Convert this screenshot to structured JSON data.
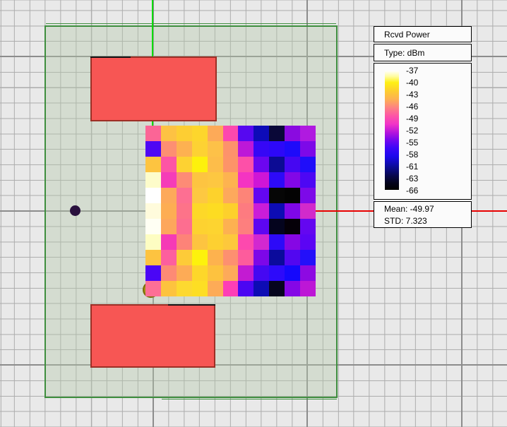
{
  "theme": {
    "bg": "#e9e9e9",
    "grid-minor": "#acacac",
    "grid-major": "#8c8c8c",
    "boundary": "#3e8e3e",
    "scene-tint": "rgba(180,200,170,0.4)",
    "axis-green": "#00dc00",
    "axis-red": "#e80000",
    "obstacle-fill": "#f75654",
    "obstacle-border": "#9c2f26",
    "marker-olive": "#a29210",
    "marker-purple": "#2a113e",
    "panel-bg": "#fbfbfb"
  },
  "legend": {
    "title": "Rcvd Power",
    "type_label": "Type: dBm",
    "ticks": [
      "-37",
      "-40",
      "-43",
      "-46",
      "-49",
      "-52",
      "-55",
      "-58",
      "-61",
      "-63",
      "-66"
    ],
    "mean_label": "Mean: -49.97",
    "std_label": "STD: 7.323",
    "colorbar_stops": [
      [
        0.0,
        "#ffffff"
      ],
      [
        0.05,
        "#fffc9e"
      ],
      [
        0.1,
        "#fff014"
      ],
      [
        0.17,
        "#fdce2e"
      ],
      [
        0.24,
        "#fdb151"
      ],
      [
        0.31,
        "#fd8282"
      ],
      [
        0.38,
        "#fd55a6"
      ],
      [
        0.45,
        "#f133c8"
      ],
      [
        0.52,
        "#b414dc"
      ],
      [
        0.58,
        "#7607ee"
      ],
      [
        0.65,
        "#3b06f8"
      ],
      [
        0.72,
        "#1c08ec"
      ],
      [
        0.8,
        "#0c0c9e"
      ],
      [
        0.88,
        "#07074e"
      ],
      [
        0.94,
        "#03031c"
      ],
      [
        1.0,
        "#000000"
      ]
    ]
  },
  "chart_data": {
    "type": "heatmap",
    "title": "Rcvd Power",
    "units": "dBm",
    "rows": 11,
    "cols": 11,
    "colorbar_ticks": [
      -37,
      -40,
      -43,
      -46,
      -49,
      -52,
      -55,
      -58,
      -61,
      -63,
      -66
    ],
    "colorbar_range": [
      -37,
      -66
    ],
    "mean": -49.97,
    "std": 7.323,
    "legend_position": "top-right",
    "cell_colors": [
      [
        "#fb6596",
        "#fdc243",
        "#fdce33",
        "#fdd62c",
        "#fdaa58",
        "#fd48ae",
        "#5608f0",
        "#0d0bb8",
        "#0a0838",
        "#8a0be0",
        "#b01ae0"
      ],
      [
        "#4e07f4",
        "#fd8f72",
        "#fdb151",
        "#fdd233",
        "#fdc148",
        "#fd926b",
        "#bd18d8",
        "#3607f6",
        "#2d08f8",
        "#1e0afa",
        "#7d09e8"
      ],
      [
        "#fdc440",
        "#fd55a4",
        "#fdd232",
        "#fdf10c",
        "#fdbd4a",
        "#fd9468",
        "#fd50a8",
        "#6c06f0",
        "#0c0b94",
        "#4607f2",
        "#1f0efa"
      ],
      [
        "#fdfcca",
        "#f53cb8",
        "#fd8b76",
        "#fdc441",
        "#fdc741",
        "#fdb350",
        "#f434c2",
        "#cf16d6",
        "#2d0af8",
        "#8207e6",
        "#4d07f4"
      ],
      [
        "#ffffff",
        "#fda95a",
        "#fd6f92",
        "#fdc841",
        "#fdd22c",
        "#fda95c",
        "#fd8478",
        "#6406f2",
        "#060606",
        "#030303",
        "#7d09e8"
      ],
      [
        "#fffbdc",
        "#fdad53",
        "#fd7389",
        "#fdd828",
        "#fddc22",
        "#fdd02c",
        "#fd7b80",
        "#cb1dd8",
        "#0d0cb4",
        "#7e07e8",
        "#d22acb"
      ],
      [
        "#fffff4",
        "#fda75c",
        "#fd6e90",
        "#fdd230",
        "#fdd430",
        "#fdb151",
        "#fd7f7e",
        "#5d06f2",
        "#04041e",
        "#050008",
        "#6407f0"
      ],
      [
        "#fdfdc2",
        "#f53ab6",
        "#fd8378",
        "#fdc440",
        "#fdd031",
        "#fdc83c",
        "#fd49ae",
        "#d228d0",
        "#2d0af8",
        "#8607e4",
        "#5b05f4"
      ],
      [
        "#fdc340",
        "#fd5f9e",
        "#fdcb38",
        "#fdf20c",
        "#fdb24e",
        "#fd9070",
        "#fd5c9c",
        "#7d07e8",
        "#0b0b9c",
        "#5207f0",
        "#2310fa"
      ],
      [
        "#4a06f6",
        "#fd8a75",
        "#fdab56",
        "#fdd72a",
        "#fdc23f",
        "#fdaa5a",
        "#c31bd2",
        "#4508f2",
        "#2d0afa",
        "#1508fc",
        "#8d0ae2"
      ],
      [
        "#fd6f96",
        "#fdc33e",
        "#fdd930",
        "#fdde24",
        "#fdab57",
        "#fd3eb6",
        "#4b06f2",
        "#0d0cb4",
        "#06051e",
        "#8507e6",
        "#bd17d6"
      ]
    ],
    "values_dbm_est": [
      [
        -48,
        -42,
        -42,
        -41,
        -44,
        -49,
        -57,
        -62,
        -65,
        -55,
        -54
      ],
      [
        -57,
        -46,
        -44,
        -42,
        -42,
        -45,
        -52,
        -58,
        -59,
        -60,
        -55
      ],
      [
        -42,
        -48,
        -42,
        -40,
        -42,
        -45,
        -49,
        -56,
        -62,
        -57,
        -59
      ],
      [
        -38,
        -50,
        -46,
        -42,
        -42,
        -44,
        -50,
        -52,
        -59,
        -55,
        -57
      ],
      [
        -37,
        -44,
        -47,
        -42,
        -41,
        -44,
        -46,
        -56,
        -66,
        -66,
        -55
      ],
      [
        -38,
        -44,
        -47,
        -41,
        -41,
        -42,
        -46,
        -52,
        -62,
        -55,
        -52
      ],
      [
        -37,
        -44,
        -47,
        -41,
        -41,
        -44,
        -46,
        -56,
        -65,
        -66,
        -56
      ],
      [
        -38,
        -50,
        -46,
        -42,
        -42,
        -42,
        -49,
        -52,
        -59,
        -55,
        -57
      ],
      [
        -42,
        -48,
        -42,
        -40,
        -43,
        -45,
        -48,
        -55,
        -62,
        -57,
        -59
      ],
      [
        -57,
        -46,
        -44,
        -41,
        -42,
        -44,
        -52,
        -57,
        -59,
        -60,
        -54
      ],
      [
        -48,
        -42,
        -41,
        -41,
        -44,
        -49,
        -57,
        -62,
        -65,
        -55,
        -52
      ]
    ]
  }
}
